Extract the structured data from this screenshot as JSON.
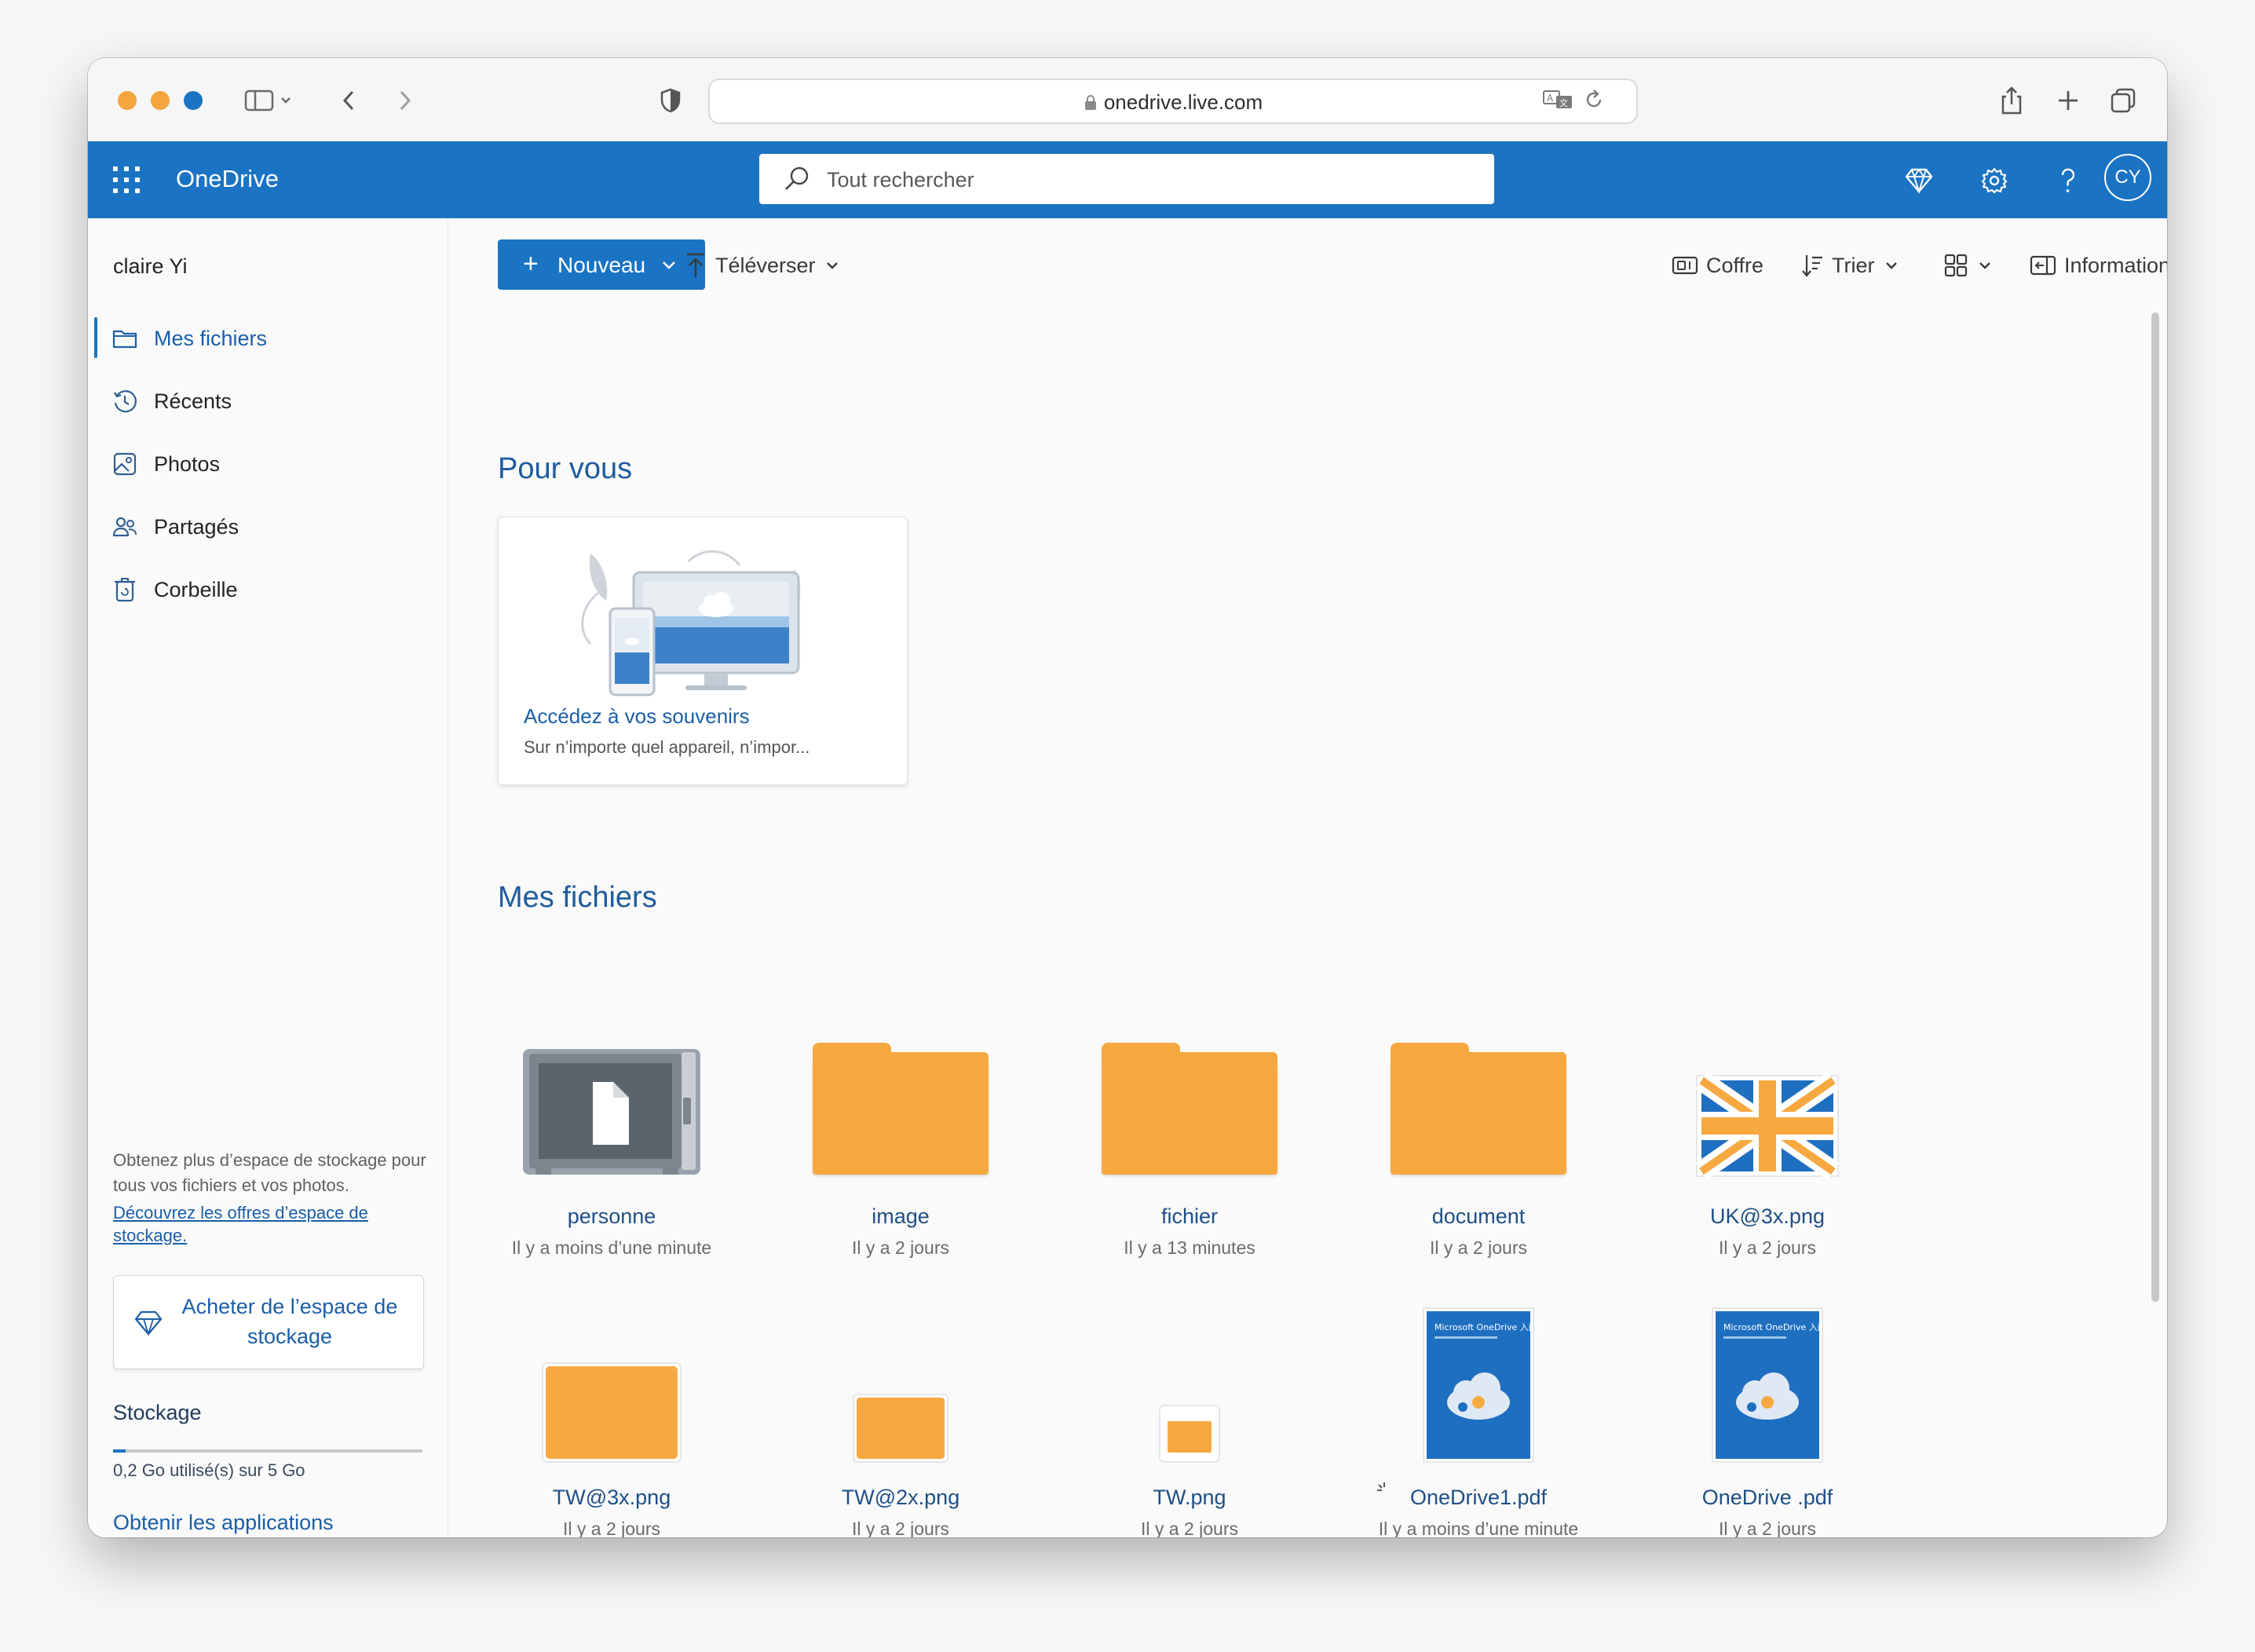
{
  "browser": {
    "url": "onedrive.live.com"
  },
  "app": {
    "title": "OneDrive",
    "search_placeholder": "Tout rechercher",
    "avatar_initials": "CY",
    "accent": "#1a73c3",
    "folder_color": "#f7a941"
  },
  "sidebar": {
    "username": "claire Yi",
    "items": [
      {
        "label": "Mes fichiers",
        "icon": "folder-icon",
        "active": true
      },
      {
        "label": "Récents",
        "icon": "history-icon"
      },
      {
        "label": "Photos",
        "icon": "photo-icon"
      },
      {
        "label": "Partagés",
        "icon": "people-icon"
      },
      {
        "label": "Corbeille",
        "icon": "recycle-bin-icon"
      }
    ],
    "promo_text": "Obtenez plus d’espace de stockage pour tous vos fichiers et vos photos.",
    "promo_link": "Découvrez les offres d’espace de stockage.",
    "buy_label": "Acheter de l’espace de stockage",
    "storage_title": "Stockage",
    "storage_used_fraction": 0.04,
    "storage_text": "0,2 Go utilisé(s) sur 5 Go",
    "get_apps": "Obtenir les applications OneDrive"
  },
  "toolbar": {
    "new_label": "Nouveau",
    "upload_label": "Téléverser",
    "vault_label": "Coffre",
    "sort_label": "Trier",
    "info_label": "Informations"
  },
  "foryou": {
    "title": "Pour vous",
    "card_title": "Accédez à vos souvenirs",
    "card_subtitle": "Sur n’importe quel appareil, n’impor..."
  },
  "files": {
    "title": "Mes fichiers",
    "items": [
      {
        "name": "personne",
        "date": "Il y a moins d’une minute",
        "kind": "vault"
      },
      {
        "name": "image",
        "date": "Il y a 2 jours",
        "kind": "folder"
      },
      {
        "name": "fichier",
        "date": "Il y a 13 minutes",
        "kind": "folder"
      },
      {
        "name": "document",
        "date": "Il y a 2 jours",
        "kind": "folder"
      },
      {
        "name": "UK@3x.png",
        "date": "Il y a 2 jours",
        "kind": "image-flag"
      },
      {
        "name": "TW@3x.png",
        "date": "Il y a 2 jours",
        "kind": "image-orange"
      },
      {
        "name": "TW@2x.png",
        "date": "Il y a 2 jours",
        "kind": "image-orange"
      },
      {
        "name": "TW.png",
        "date": "Il y a 2 jours",
        "kind": "image-orange"
      },
      {
        "name": "OneDrive1.pdf",
        "date": "Il y a moins d’une minute",
        "kind": "pdf"
      },
      {
        "name": "OneDrive .pdf",
        "date": "Il y a 2 jours",
        "kind": "pdf"
      }
    ],
    "pdf_thumb_title": "Microsoft OneDrive 入门"
  }
}
